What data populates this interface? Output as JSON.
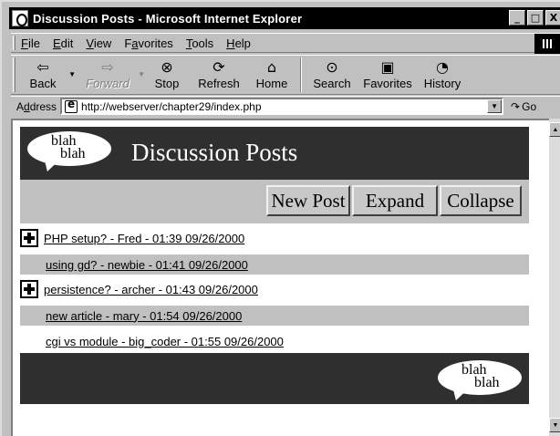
{
  "window": {
    "title": "Discussion Posts - Microsoft Internet Explorer",
    "min_glyph": "_",
    "max_glyph": "□",
    "close_glyph": "X"
  },
  "menu": {
    "items": [
      {
        "accel": "F",
        "rest": "ile"
      },
      {
        "accel": "E",
        "rest": "dit"
      },
      {
        "accel": "V",
        "rest": "iew"
      },
      {
        "pre": "F",
        "accel": "a",
        "rest": "vorites"
      },
      {
        "accel": "T",
        "rest": "ools"
      },
      {
        "accel": "H",
        "rest": "elp"
      }
    ]
  },
  "toolbar": {
    "back": "Back",
    "forward": "Forward",
    "stop": "Stop",
    "refresh": "Refresh",
    "home": "Home",
    "search": "Search",
    "favorites": "Favorites",
    "history": "History"
  },
  "address": {
    "label_pre": "A",
    "label_accel": "d",
    "label_rest": "dress",
    "url": "http://webserver/chapter29/index.php",
    "go": "Go"
  },
  "page": {
    "logo_line1": "blah",
    "logo_line2": "blah",
    "title": "Discussion Posts",
    "buttons": {
      "new_post": "New Post",
      "expand": "Expand",
      "collapse": "Collapse"
    },
    "posts": [
      {
        "text": "PHP setup? - Fred - 01:39 09/26/2000",
        "expandable": true,
        "shaded": false,
        "indent": false
      },
      {
        "text": "using gd? - newbie - 01:41 09/26/2000",
        "expandable": false,
        "shaded": true,
        "indent": true
      },
      {
        "text": "persistence? - archer - 01:43 09/26/2000",
        "expandable": true,
        "shaded": false,
        "indent": false
      },
      {
        "text": "new article - mary - 01:54 09/26/2000",
        "expandable": false,
        "shaded": true,
        "indent": true
      },
      {
        "text": "cgi vs module - big_coder - 01:55 09/26/2000",
        "expandable": false,
        "shaded": false,
        "indent": true
      }
    ]
  },
  "colors": {
    "header_bg": "#2f2f2f",
    "shade_bg": "#c0c0c0",
    "title_bar": "#000000"
  }
}
